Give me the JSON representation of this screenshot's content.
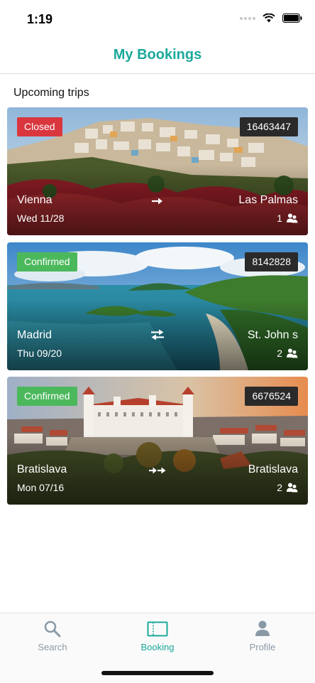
{
  "status_bar": {
    "time": "1:19"
  },
  "nav": {
    "title": "My Bookings"
  },
  "section": {
    "title": "Upcoming trips"
  },
  "bookings": [
    {
      "status": "Closed",
      "booking_id": "16463447",
      "from": "Vienna",
      "to": "Las Palmas",
      "date": "Wed 11/28",
      "passengers": "1",
      "trip_icon": "one-way-arrow-icon"
    },
    {
      "status": "Confirmed",
      "booking_id": "8142828",
      "from": "Madrid",
      "to": "St. John s",
      "date": "Thu 09/20",
      "passengers": "2",
      "trip_icon": "round-trip-arrows-icon"
    },
    {
      "status": "Confirmed",
      "booking_id": "6676524",
      "from": "Bratislava",
      "to": "Bratislava",
      "date": "Mon 07/16",
      "passengers": "2",
      "trip_icon": "multi-city-arrows-icon"
    }
  ],
  "tabs": [
    {
      "label": "Search",
      "icon": "search-icon"
    },
    {
      "label": "Booking",
      "icon": "ticket-icon",
      "active": true
    },
    {
      "label": "Profile",
      "icon": "person-icon"
    }
  ],
  "colors": {
    "accent": "#1aa99b",
    "closed": "#d9363e",
    "confirmed": "#4cb85c",
    "tab_inactive": "#8a99a6"
  }
}
